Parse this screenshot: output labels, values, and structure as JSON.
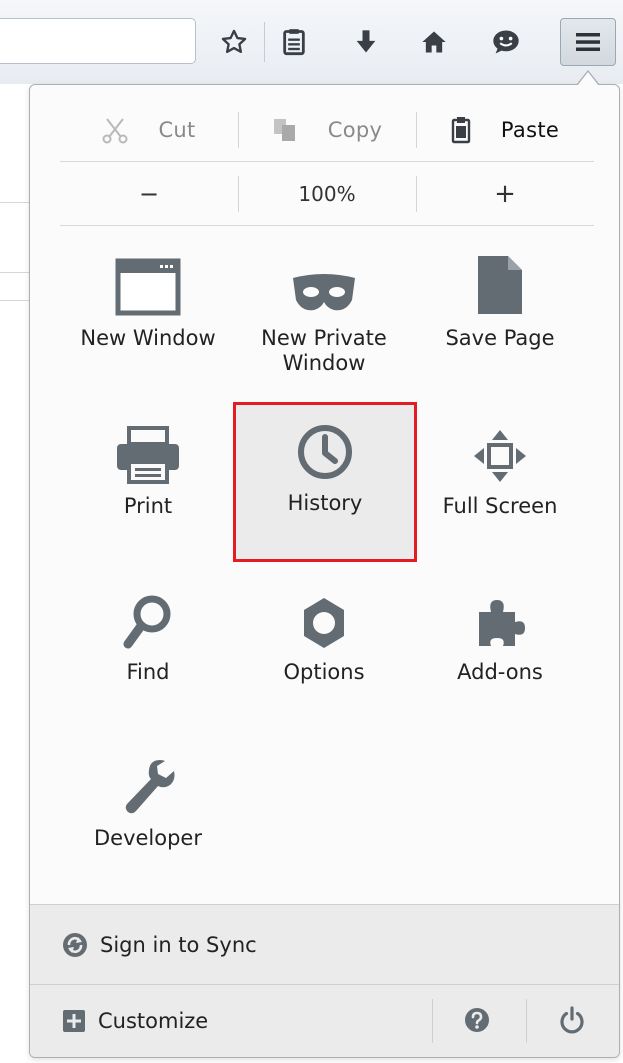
{
  "toolbar": {
    "icons": [
      "star-icon",
      "reading-list-icon",
      "download-icon",
      "home-icon",
      "chat-icon"
    ],
    "menu_icon": "hamburger-icon"
  },
  "edit": {
    "cut": "Cut",
    "copy": "Copy",
    "paste": "Paste"
  },
  "zoom": {
    "minus": "−",
    "level": "100%",
    "plus": "+"
  },
  "grid": {
    "new_window": "New Window",
    "new_private_window": "New Private\nWindow",
    "save_page": "Save Page",
    "print": "Print",
    "history": "History",
    "full_screen": "Full Screen",
    "find": "Find",
    "options": "Options",
    "add_ons": "Add-ons",
    "developer": "Developer"
  },
  "footer": {
    "sign_in": "Sign in to Sync",
    "customize": "Customize"
  },
  "colors": {
    "highlight_border": "#e31b23",
    "icon_gray": "#636b73"
  }
}
